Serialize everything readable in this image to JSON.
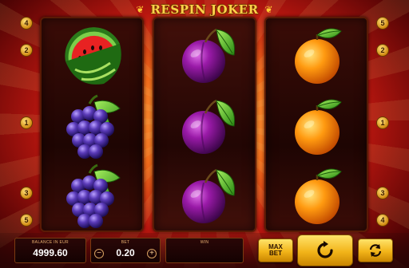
{
  "game": {
    "title": "RESPIN JOKER"
  },
  "reels": [
    {
      "symbols": [
        "watermelon",
        "grapes",
        "grapes"
      ]
    },
    {
      "symbols": [
        "plum",
        "plum",
        "plum"
      ]
    },
    {
      "symbols": [
        "orange",
        "orange",
        "orange"
      ]
    }
  ],
  "paylines": {
    "left": [
      "4",
      "2",
      "1",
      "3",
      "5"
    ],
    "right": [
      "5",
      "2",
      "1",
      "3",
      "4"
    ]
  },
  "controls": {
    "balance_label": "BALANCE IN EUR",
    "balance_value": "4999.60",
    "bet_label": "BET",
    "bet_value": "0.20",
    "bet_minus": "−",
    "bet_plus": "+",
    "win_label": "WIN",
    "win_value": "",
    "maxbet_line1": "MAX",
    "maxbet_line2": "BET"
  },
  "icons": {
    "spin": "spin-arrow-icon",
    "autoplay": "autoplay-icon",
    "watermelon": "watermelon-icon",
    "grapes": "grapes-icon",
    "plum": "plum-icon",
    "orange": "orange-icon"
  },
  "colors": {
    "gold": "#f2b419",
    "reel_bg": "#220604",
    "title": "#ffd24a"
  }
}
